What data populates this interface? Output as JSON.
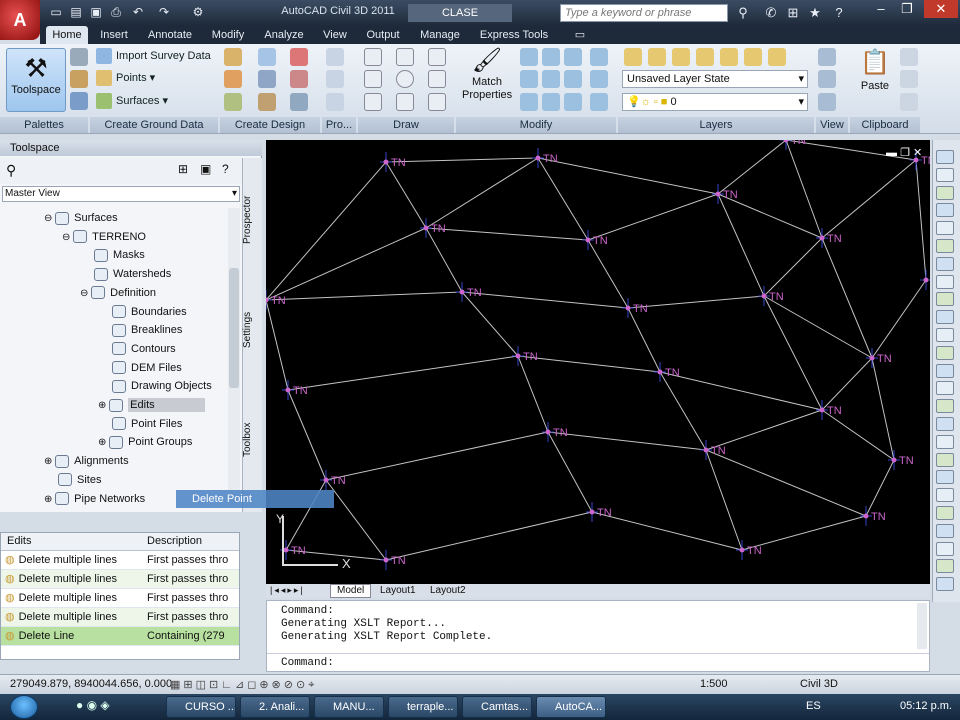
{
  "window": {
    "app_title": "AutoCAD Civil 3D 2011",
    "doc_title": "CLASE SUPERFICIES",
    "search_placeholder": "Type a keyword or phrase"
  },
  "ribbon": {
    "tabs": [
      "Home",
      "Insert",
      "Annotate",
      "Modify",
      "Analyze",
      "View",
      "Output",
      "Manage",
      "Express Tools"
    ],
    "active_tab": "Home",
    "toolspace_label": "Toolspace",
    "import_survey": "Import Survey Data",
    "points": "Points",
    "surfaces": "Surfaces",
    "match_properties": "Match Properties",
    "layer_state": "Unsaved Layer State",
    "layer_name": "0",
    "paste": "Paste",
    "panels": [
      "Palettes",
      "Create Ground Data",
      "Create Design",
      "Pro...",
      "Draw",
      "Modify",
      "Layers",
      "View",
      "Clipboard"
    ]
  },
  "toolspace": {
    "title": "Toolspace",
    "view": "Master View",
    "tree": [
      {
        "label": "Surfaces",
        "level": 0,
        "expand": "-"
      },
      {
        "label": "TERRENO",
        "level": 1,
        "expand": "-"
      },
      {
        "label": "Masks",
        "level": 2,
        "expand": ""
      },
      {
        "label": "Watersheds",
        "level": 2,
        "expand": ""
      },
      {
        "label": "Definition",
        "level": 2,
        "expand": "-"
      },
      {
        "label": "Boundaries",
        "level": 3,
        "expand": ""
      },
      {
        "label": "Breaklines",
        "level": 3,
        "expand": ""
      },
      {
        "label": "Contours",
        "level": 3,
        "expand": ""
      },
      {
        "label": "DEM Files",
        "level": 3,
        "expand": ""
      },
      {
        "label": "Drawing Objects",
        "level": 3,
        "expand": ""
      },
      {
        "label": "Edits",
        "level": 3,
        "expand": "+"
      },
      {
        "label": "Point Files",
        "level": 3,
        "expand": ""
      },
      {
        "label": "Point Groups",
        "level": 3,
        "expand": "+"
      },
      {
        "label": "Alignments",
        "level": 0,
        "expand": "+"
      },
      {
        "label": "Sites",
        "level": 0,
        "expand": ""
      },
      {
        "label": "Pipe Networks",
        "level": 0,
        "expand": "+"
      }
    ],
    "vertical_tabs": [
      "Prospector",
      "Settings",
      "Toolbox"
    ],
    "drag_label": "Delete Point"
  },
  "edits_table": {
    "headers": [
      "Edits",
      "Description"
    ],
    "rows": [
      [
        "Delete multiple lines",
        "First passes thro"
      ],
      [
        "Delete multiple lines",
        "First passes thro"
      ],
      [
        "Delete multiple lines",
        "First passes thro"
      ],
      [
        "Delete multiple lines",
        "First passes thro"
      ],
      [
        "Delete Line",
        "Containing (279"
      ]
    ]
  },
  "viewport": {
    "point_label": "TN",
    "ucs_x": "X",
    "ucs_y": "Y"
  },
  "layout_tabs": [
    "Model",
    "Layout1",
    "Layout2"
  ],
  "command_lines": [
    "Command:",
    "Generating XSLT Report...",
    "Generating XSLT Report Complete."
  ],
  "command_prompt": "Command:",
  "status": {
    "coordinates": "279049.879, 8940044.656, 0.000",
    "scale": "1:500",
    "workspace": "Civil 3D",
    "clock": "05:12 p.m."
  },
  "taskbar": [
    {
      "label": "CURSO ...",
      "active": false
    },
    {
      "label": "2. Anali...",
      "active": false
    },
    {
      "label": "MANU...",
      "active": false
    },
    {
      "label": "terraple...",
      "active": false
    },
    {
      "label": "Camtas...",
      "active": false
    },
    {
      "label": "AutoCA...",
      "active": true
    }
  ],
  "tray": {
    "lang": "ES"
  },
  "colors": {
    "accent": "#4f86c6",
    "viewport_bg": "#000000",
    "point_marker": "#cc66cc",
    "triangle_line": "#e6e6e6"
  }
}
